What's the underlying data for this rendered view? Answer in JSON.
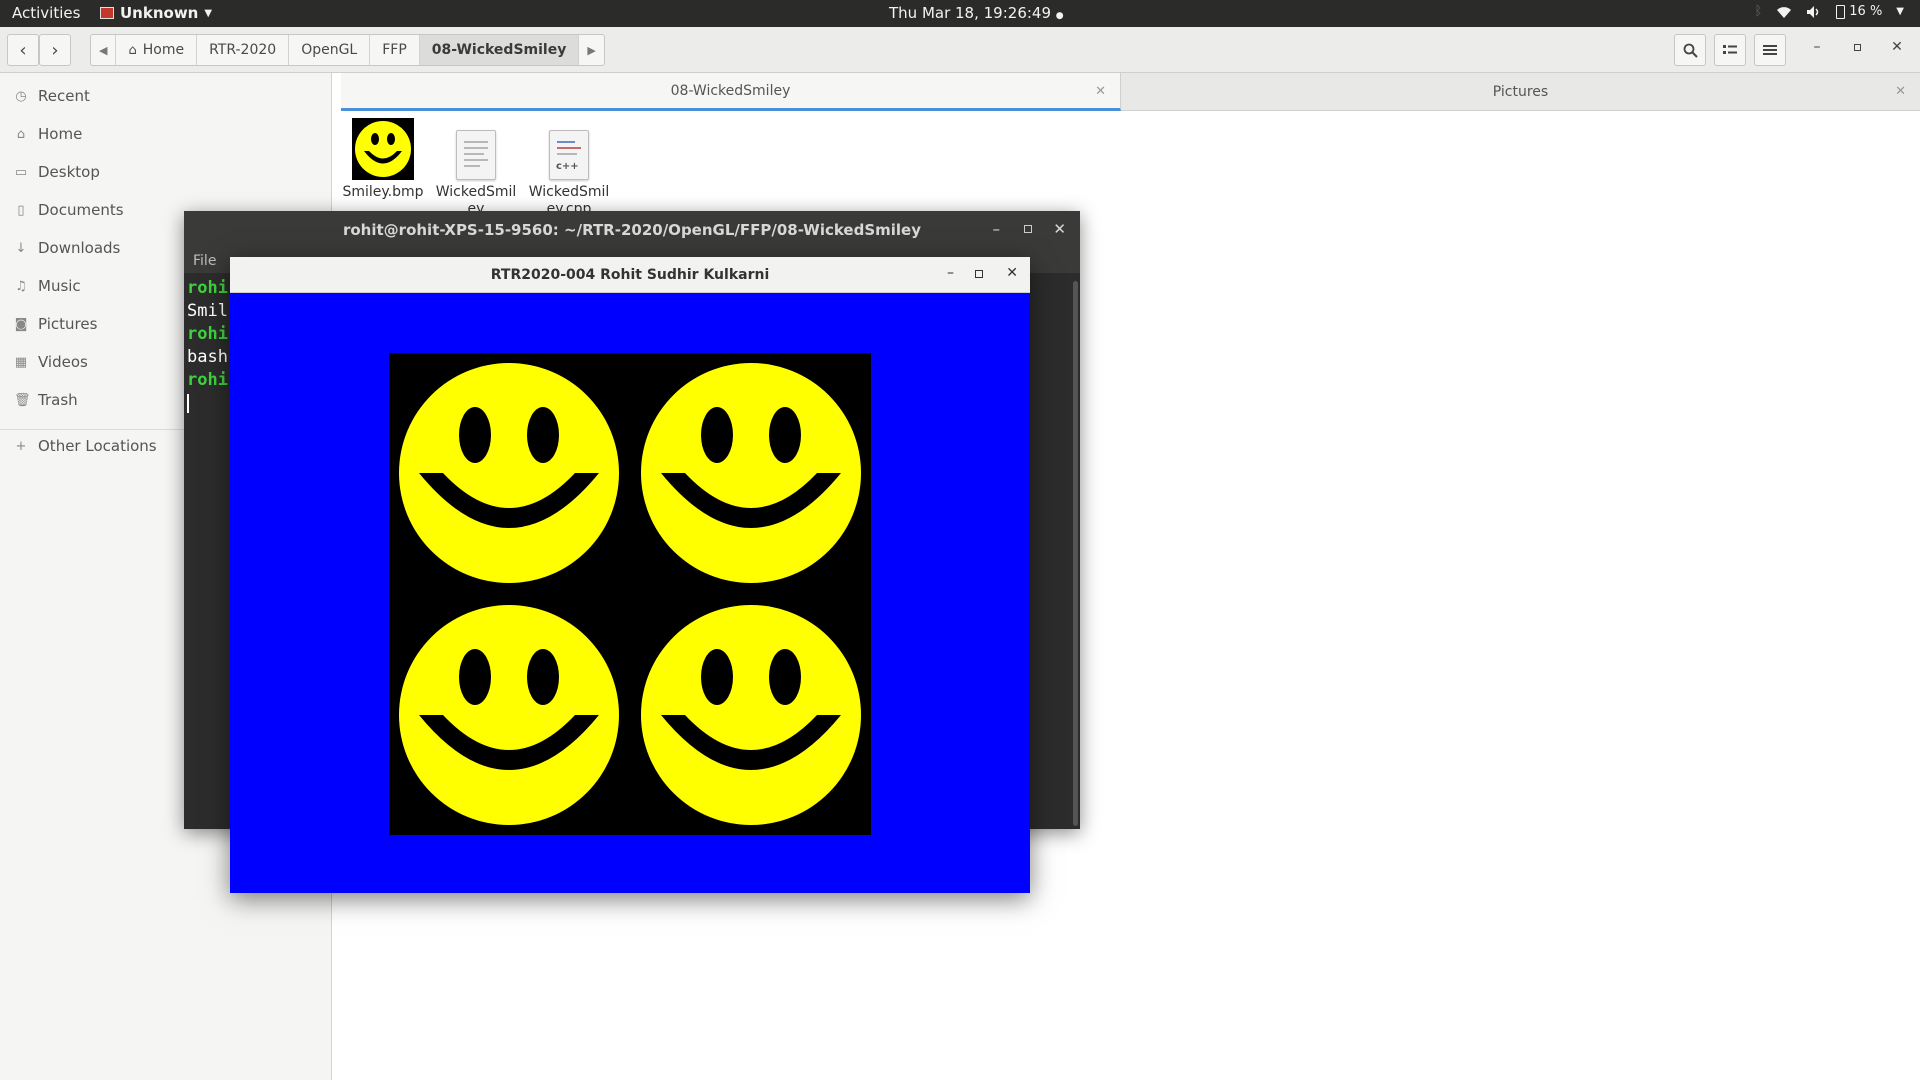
{
  "top_panel": {
    "activities": "Activities",
    "app_name": "Unknown",
    "clock": "Thu Mar 18, 19:26:49",
    "battery": "16 %"
  },
  "toolbar": {
    "breadcrumbs": [
      "Home",
      "RTR-2020",
      "OpenGL",
      "FFP",
      "08-WickedSmiley"
    ]
  },
  "sidebar": {
    "items": [
      {
        "label": "Recent",
        "icon": "clock-icon"
      },
      {
        "label": "Home",
        "icon": "home-icon"
      },
      {
        "label": "Desktop",
        "icon": "folder-icon"
      },
      {
        "label": "Documents",
        "icon": "document-icon"
      },
      {
        "label": "Downloads",
        "icon": "download-icon"
      },
      {
        "label": "Music",
        "icon": "music-icon"
      },
      {
        "label": "Pictures",
        "icon": "camera-icon"
      },
      {
        "label": "Videos",
        "icon": "film-icon"
      },
      {
        "label": "Trash",
        "icon": "trash-icon"
      }
    ],
    "other_locations": "Other Locations"
  },
  "tabs": [
    {
      "label": "08-WickedSmiley",
      "active": true
    },
    {
      "label": "Pictures",
      "active": false
    }
  ],
  "files": [
    {
      "name": "Smiley.bmp",
      "icon": "smiley-image-icon"
    },
    {
      "name": "WickedSmiley",
      "icon": "text-file-icon"
    },
    {
      "name": "WickedSmiley.cpp",
      "icon": "cpp-file-icon"
    }
  ],
  "terminal": {
    "title": "rohit@rohit-XPS-15-9560: ~/RTR-2020/OpenGL/FFP/08-WickedSmiley",
    "menu_file": "File",
    "lines": [
      "rohi",
      "Smil",
      "rohi",
      "bash",
      "rohi"
    ]
  },
  "gl_window": {
    "title": "RTR2020-004 Rohit Sudhir Kulkarni"
  },
  "colors": {
    "gl_background": "#0000ff",
    "smiley_yellow": "#ffff00",
    "prompt_green": "#3fd33f",
    "tab_accent": "#4a90d9"
  }
}
